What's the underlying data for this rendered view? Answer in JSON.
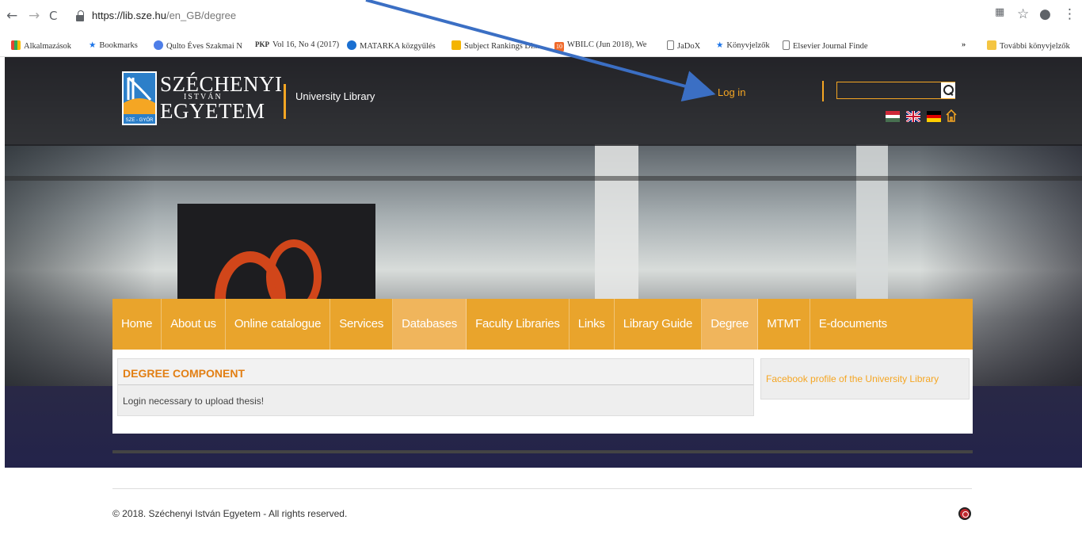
{
  "browser": {
    "url_host": "https://lib.sze.hu",
    "url_path": "/en_GB/degree",
    "back": "←",
    "forward": "→",
    "reload": "C",
    "bookmarks": [
      {
        "label": "Alkalmazások",
        "color": "#e94235"
      },
      {
        "label": "Bookmarks",
        "color": "#1a73e8"
      },
      {
        "label": "Qulto Éves Szakmai N",
        "color": "#4e7ee8"
      },
      {
        "label": "Vol 16, No 4 (2017)",
        "prefix": "PKP",
        "color": "#222222"
      },
      {
        "label": "MATARKA közgyűlés",
        "color": "#1a6fd1"
      },
      {
        "label": "Subject Rankings Di...",
        "color": "#f4b400"
      },
      {
        "label": "WBILC (Jun 2018), We",
        "prefix": "10",
        "color": "#f06a2b"
      },
      {
        "label": "JaDoX",
        "color": "#999999"
      },
      {
        "label": "Könyvjelzők",
        "color": "#1a73e8"
      },
      {
        "label": "Elsevier Journal Finde",
        "color": "#999999"
      }
    ],
    "more_bookmarks_chevron": "»",
    "other_bookmarks": "További könyvjelzők"
  },
  "site": {
    "logo_line1": "SZÉCHENYI",
    "logo_line2": "ISTVÁN",
    "logo_line3": "EGYETEM",
    "logo_badge": "SZE - GYŐR",
    "subtitle": "University Library",
    "login": "Log in",
    "search_placeholder": "",
    "menu": [
      {
        "label": "Home",
        "active": false
      },
      {
        "label": "About us",
        "active": false
      },
      {
        "label": "Online catalogue",
        "active": false
      },
      {
        "label": "Services",
        "active": false
      },
      {
        "label": "Databases",
        "active": true
      },
      {
        "label": "Faculty Libraries",
        "active": false
      },
      {
        "label": "Links",
        "active": false
      },
      {
        "label": "Library Guide",
        "active": false
      },
      {
        "label": "Degree",
        "active": true
      },
      {
        "label": "MTMT",
        "active": false
      },
      {
        "label": "E-documents",
        "active": false
      }
    ],
    "panel_title": "DEGREE COMPONENT",
    "panel_message": "Login necessary to upload thesis!",
    "facebook_link": "Facebook profile of the University Library",
    "footer": "© 2018. Széchenyi István Egyetem - All rights reserved.",
    "colors": {
      "accent": "#e9a42c",
      "title": "#e27f14",
      "link": "#f5a623"
    }
  }
}
